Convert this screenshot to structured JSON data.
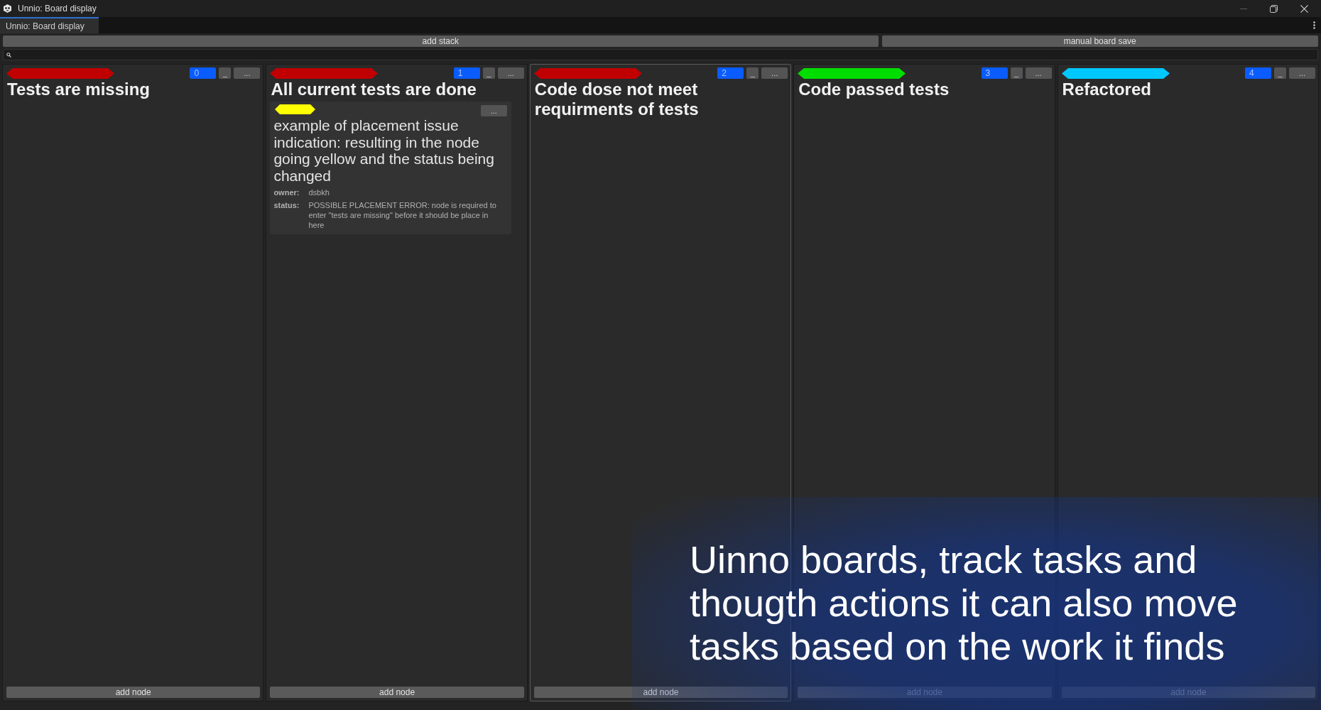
{
  "window": {
    "title": "Unnio: Board display"
  },
  "tabs": [
    {
      "label": "Unnio: Board display",
      "selected": true
    }
  ],
  "toolbar": {
    "buttons": [
      "add stack",
      "manual board save"
    ]
  },
  "stacks": [
    {
      "color": "#c00000",
      "count": "0",
      "collapse_button": "_",
      "menu_button": "...",
      "title": "Tests are missing",
      "selected": false,
      "add_button": "add node"
    },
    {
      "color": "#c00000",
      "count": "1",
      "collapse_button": "_",
      "menu_button": "...",
      "title": "All current tests are done",
      "selected": false,
      "nodes": [
        {
          "color": "#ffff00",
          "menu_button": "...",
          "text": "example of placement issue indication: resulting in the node going yellow and the status being changed",
          "fields": [
            {
              "label": "owner:",
              "value": "dsbkh"
            },
            {
              "label": "status:",
              "value": "POSSIBLE PLACEMENT ERROR: node is required to enter \"tests are missing\" before it should be place in here"
            }
          ]
        }
      ],
      "add_button": "add node"
    },
    {
      "color": "#c00000",
      "count": "2",
      "collapse_button": "_",
      "menu_button": "...",
      "title": "Code dose not meet requirments of tests",
      "selected": true,
      "add_button": "add node"
    },
    {
      "color": "#00dd00",
      "count": "3",
      "collapse_button": "_",
      "menu_button": "...",
      "title": "Code passed tests",
      "selected": false,
      "add_button": "add node"
    },
    {
      "color": "#00c8ff",
      "count": "4",
      "collapse_button": "_",
      "menu_button": "...",
      "title": "Refactored",
      "selected": false,
      "add_button": "add node"
    }
  ],
  "caption": "Uinno boards, track tasks and thougth actions it can also move tasks based on the work it finds"
}
